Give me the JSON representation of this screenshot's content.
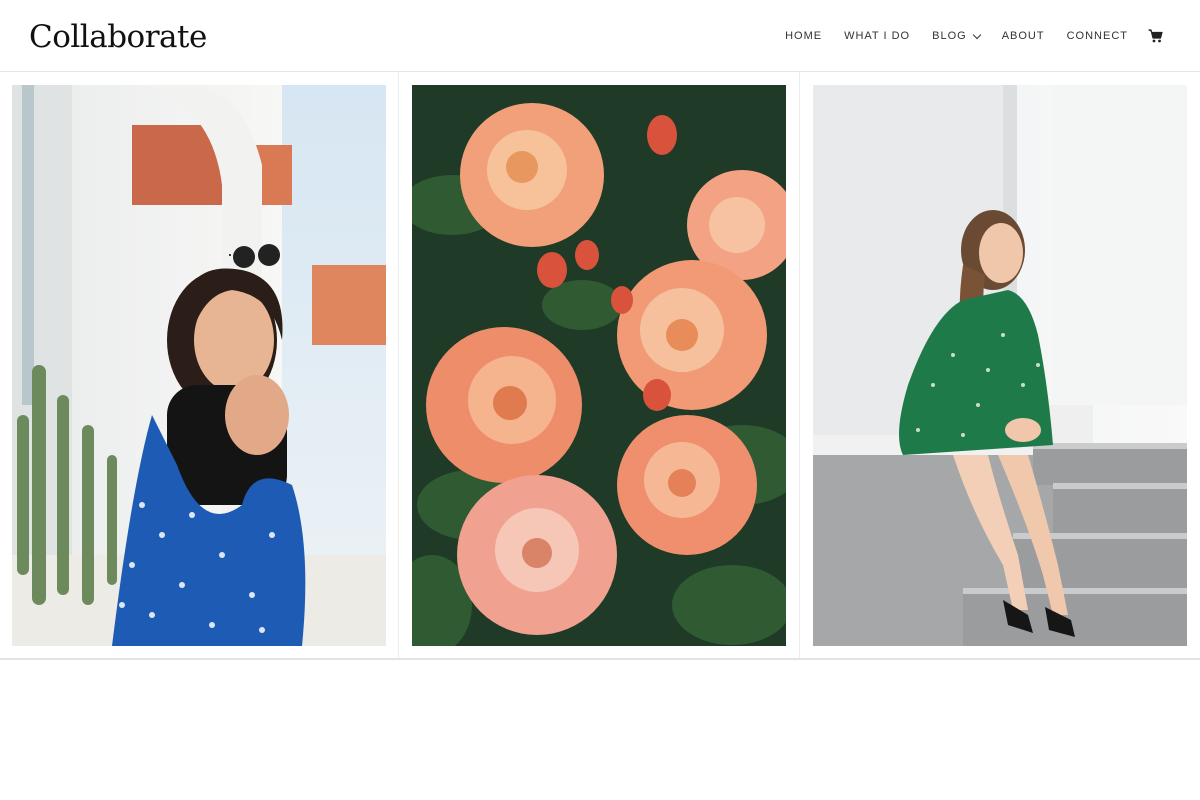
{
  "header": {
    "logo": "Collaborate",
    "nav": [
      {
        "label": "HOME",
        "dropdown": false
      },
      {
        "label": "WHAT I DO",
        "dropdown": false
      },
      {
        "label": "BLOG",
        "dropdown": true
      },
      {
        "label": "ABOUT",
        "dropdown": false
      },
      {
        "label": "CONNECT",
        "dropdown": false
      }
    ],
    "cart_icon": "shopping-cart-icon"
  },
  "gallery": {
    "photos": [
      {
        "subject": "woman-in-blue-floral-dress-and-sunglasses"
      },
      {
        "subject": "peach-roses"
      },
      {
        "subject": "woman-in-green-dress-on-stone-steps"
      }
    ]
  }
}
